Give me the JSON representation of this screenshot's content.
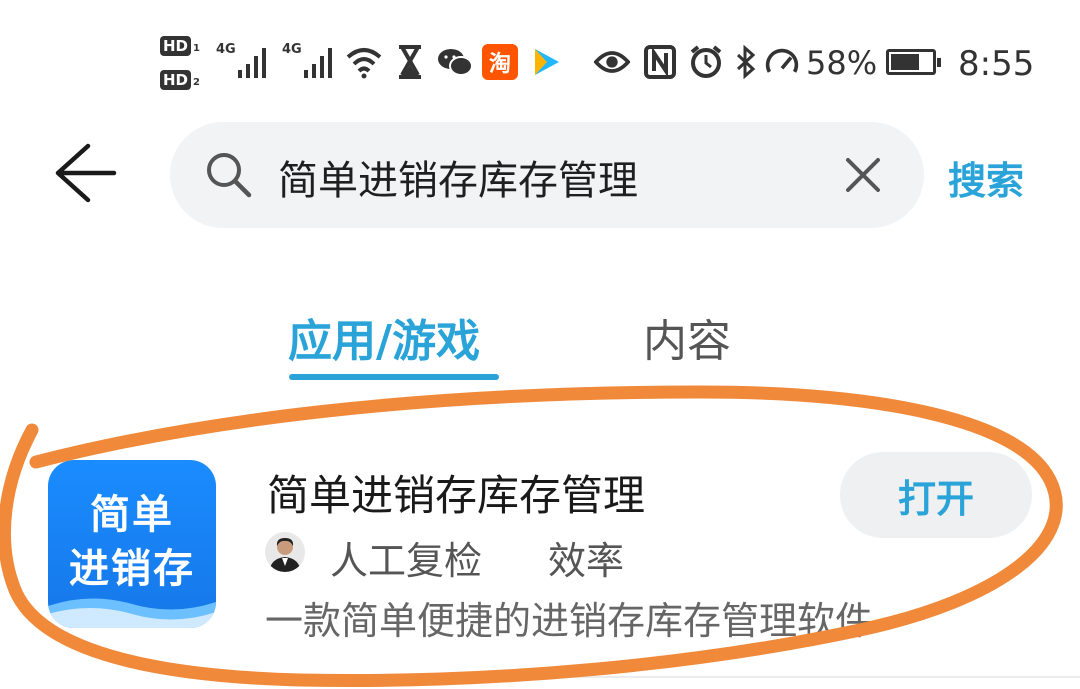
{
  "status_bar": {
    "hd1": "HD",
    "hd1_sim": "1",
    "hd2": "HD",
    "hd2_sim": "2",
    "net1": "4G",
    "net2": "4G",
    "icons": [
      "hd-icon",
      "signal-icon",
      "signal-icon",
      "wifi-icon",
      "hourglass-icon",
      "wechat-icon",
      "taobao-icon",
      "video-play-icon",
      "eye-icon",
      "nfc-icon",
      "alarm-icon",
      "bluetooth-icon",
      "speed-icon",
      "battery-icon"
    ],
    "taobao_label": "淘",
    "battery_percent": "58%",
    "time": "8:55"
  },
  "header": {
    "search_query": "简单进销存库存管理",
    "search_button": "搜索"
  },
  "tabs": [
    {
      "label": "应用/游戏",
      "active": true
    },
    {
      "label": "内容",
      "active": false
    }
  ],
  "result": {
    "icon_line1": "简单",
    "icon_line2": "进销存",
    "title": "简单进销存库存管理",
    "developer": "人工复检",
    "category": "效率",
    "description": "一款简单便捷的进销存库存管理软件",
    "open_button": "打开"
  },
  "colors": {
    "accent": "#2aa3d8",
    "annotation": "#f0893a",
    "icon_blue": "#1a8cff"
  }
}
